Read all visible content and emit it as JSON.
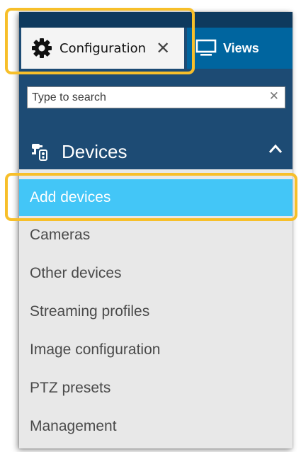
{
  "tabs": {
    "configuration": {
      "label": "Configuration",
      "close": "✕"
    },
    "views": {
      "label": "Views"
    }
  },
  "search": {
    "placeholder": "Type to search",
    "clear": "✕"
  },
  "section": {
    "label": "Devices"
  },
  "menu": {
    "items": [
      {
        "label": "Add devices",
        "active": true
      },
      {
        "label": "Cameras"
      },
      {
        "label": "Other devices"
      },
      {
        "label": "Streaming profiles"
      },
      {
        "label": "Image configuration"
      },
      {
        "label": "PTZ presets"
      },
      {
        "label": "Management"
      }
    ]
  },
  "colors": {
    "header_dark": "#1d4b74",
    "tab_views": "#00659f",
    "active_item": "#43c6f7",
    "highlight": "#f7bf2a",
    "list_bg": "#e8e8e8"
  },
  "icons": {
    "configuration_tab": "gear-icon",
    "views_tab": "monitor-icon",
    "section": "devices-icon",
    "section_toggle": "chevron-up-icon",
    "search_clear": "close-icon",
    "tab_close": "close-icon"
  }
}
